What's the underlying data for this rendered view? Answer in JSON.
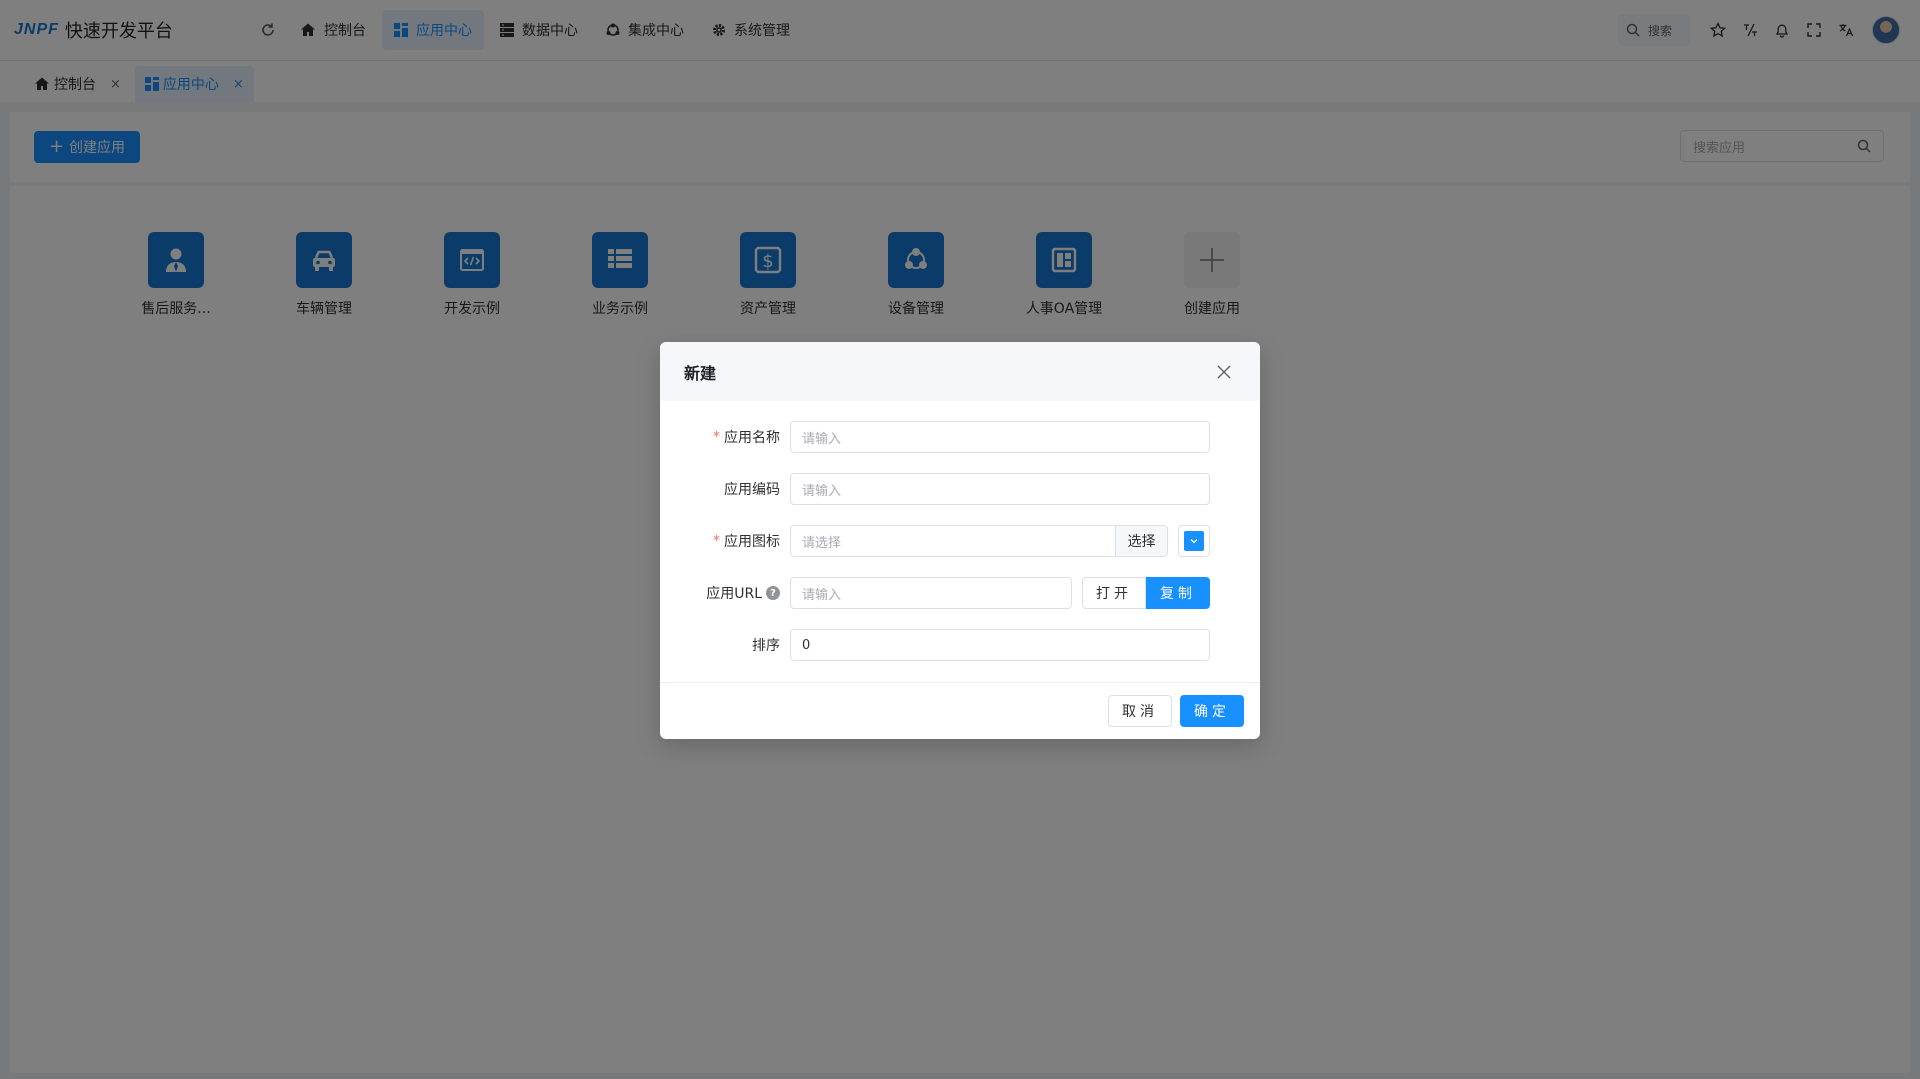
{
  "header": {
    "logo_mark": "JNPF",
    "logo_text": "快速开发平台",
    "nav": [
      {
        "label": "控制台",
        "icon": "home-icon"
      },
      {
        "label": "应用中心",
        "icon": "grid-icon",
        "active": true
      },
      {
        "label": "数据中心",
        "icon": "database-icon"
      },
      {
        "label": "集成中心",
        "icon": "integration-icon"
      },
      {
        "label": "系统管理",
        "icon": "gear-icon"
      }
    ],
    "search_label": "搜索"
  },
  "tabs": [
    {
      "label": "控制台",
      "close": "×"
    },
    {
      "label": "应用中心",
      "close": "×",
      "active": true
    }
  ],
  "toolbar": {
    "create_label": "创建应用",
    "search_placeholder": "搜索应用"
  },
  "apps": [
    {
      "label": "售后服务...",
      "icon": "user-service-icon"
    },
    {
      "label": "车辆管理",
      "icon": "car-icon"
    },
    {
      "label": "开发示例",
      "icon": "code-window-icon"
    },
    {
      "label": "业务示例",
      "icon": "list-icon"
    },
    {
      "label": "资产管理",
      "icon": "dollar-icon"
    },
    {
      "label": "设备管理",
      "icon": "nodes-icon"
    },
    {
      "label": "人事OA管理",
      "icon": "document-icon"
    },
    {
      "label": "创建应用",
      "icon": "plus-icon"
    }
  ],
  "dialog": {
    "title": "新建",
    "fields": {
      "name": {
        "label": "应用名称",
        "placeholder": "请输入",
        "required": true
      },
      "code": {
        "label": "应用编码",
        "placeholder": "请输入"
      },
      "icon": {
        "label": "应用图标",
        "placeholder": "请选择",
        "required": true,
        "select_label": "选择",
        "color": "#1890ff"
      },
      "url": {
        "label": "应用URL",
        "placeholder": "请输入",
        "help": "?",
        "open_label": "打开",
        "copy_label": "复制"
      },
      "sort": {
        "label": "排序",
        "value": "0"
      }
    },
    "required_mark": "*",
    "cancel_label": "取消",
    "ok_label": "确定"
  },
  "colors": {
    "primary": "#1890ff",
    "app_icon_bg": "#1677d2",
    "mask": "rgba(0,0,0,0.5)"
  }
}
